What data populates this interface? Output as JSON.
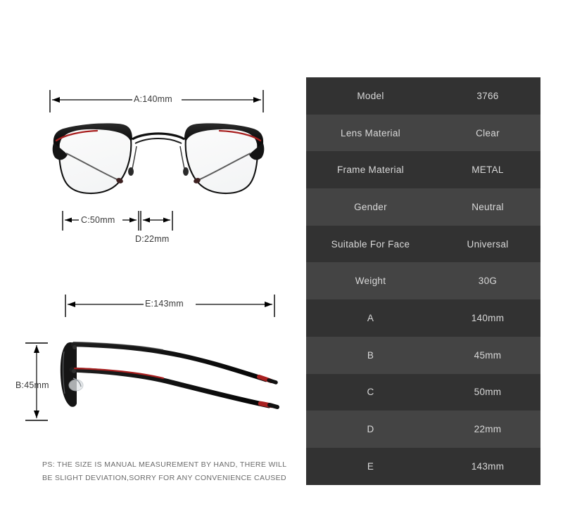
{
  "product": {
    "type": "eyeglasses-frame",
    "style": "browline",
    "front_view_alt": "eyeglasses front view",
    "side_view_alt": "eyeglasses side view"
  },
  "dimensions": {
    "front": [
      {
        "id": "A",
        "label": "A:140mm",
        "name": "total-frame-width",
        "value": 140,
        "unit": "mm"
      },
      {
        "id": "C",
        "label": "C:50mm",
        "name": "lens-width",
        "value": 50,
        "unit": "mm"
      },
      {
        "id": "D",
        "label": "D:22mm",
        "name": "bridge-width",
        "value": 22,
        "unit": "mm"
      }
    ],
    "side": [
      {
        "id": "E",
        "label": "E:143mm",
        "name": "temple-length",
        "value": 143,
        "unit": "mm"
      },
      {
        "id": "B",
        "label": "B:45mm",
        "name": "lens-height",
        "value": 45,
        "unit": "mm"
      }
    ]
  },
  "spec_table": {
    "rows": [
      {
        "key": "Model",
        "value": "3766"
      },
      {
        "key": "Lens Material",
        "value": "Clear"
      },
      {
        "key": "Frame Material",
        "value": "METAL"
      },
      {
        "key": "Gender",
        "value": "Neutral"
      },
      {
        "key": "Suitable For Face",
        "value": "Universal"
      },
      {
        "key": "Weight",
        "value": "30G"
      },
      {
        "key": "A",
        "value": "140mm"
      },
      {
        "key": "B",
        "value": "45mm"
      },
      {
        "key": "C",
        "value": "50mm"
      },
      {
        "key": "D",
        "value": "22mm"
      },
      {
        "key": "E",
        "value": "143mm"
      }
    ]
  },
  "disclaimer": {
    "line1": "PS: THE SIZE IS MANUAL MEASUREMENT BY HAND, THERE WILL",
    "line2": "BE SLIGHT DEVIATION,SORRY FOR ANY CONVENIENCE CAUSED"
  },
  "colors": {
    "row_dark": "#323232",
    "row_light": "#444444",
    "text_light": "#d9d9d9",
    "frame_black": "#1a1a1a",
    "frame_accent_red": "#a81f1f",
    "dim_line": "#000000",
    "disclaimer_text": "#6a6a6a",
    "page_background": "#ffffff"
  }
}
